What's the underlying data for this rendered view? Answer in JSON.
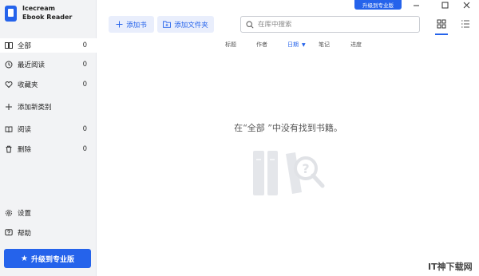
{
  "app": {
    "name_line1": "Icecream",
    "name_line2": "Ebook Reader"
  },
  "topbar": {
    "upgrade_label": "升级到专业版",
    "add_book_label": "添加书",
    "add_folder_label": "添加文件夹",
    "search_placeholder": "在库中搜索"
  },
  "sidebar": {
    "items": [
      {
        "label": "全部",
        "count": "0",
        "icon": "book-icon"
      },
      {
        "label": "最近阅读",
        "count": "0",
        "icon": "history-icon"
      },
      {
        "label": "收藏夹",
        "count": "0",
        "icon": "heart-icon"
      },
      {
        "label": "添加新类别",
        "count": "",
        "icon": "plus-icon"
      },
      {
        "label": "阅读",
        "count": "0",
        "icon": "reading-icon"
      },
      {
        "label": "删除",
        "count": "0",
        "icon": "trash-icon"
      }
    ],
    "settings_label": "设置",
    "help_label": "帮助",
    "upgrade_label": "升级到专业版"
  },
  "sort_bar": {
    "title": "标题",
    "author": "作者",
    "date": "日期",
    "notes": "笔记",
    "progress": "进度"
  },
  "main": {
    "empty_message": "在“全部 ”中没有找到书籍。"
  },
  "watermark": "IT神下载网",
  "colors": {
    "accent": "#2563eb",
    "sidebar_bg": "#f2f3f5"
  }
}
